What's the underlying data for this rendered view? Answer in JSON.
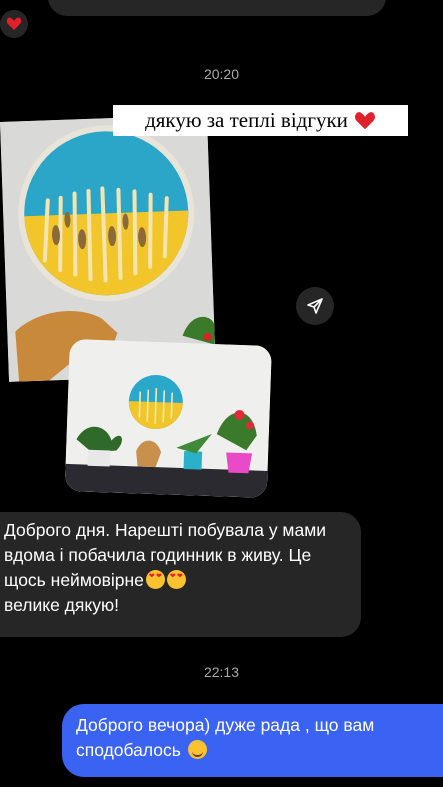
{
  "previous_message": {
    "reaction": "heart-emoji"
  },
  "time_1": "20:20",
  "story_caption": "дякую за теплі відгуки",
  "caption_icon": "heart-emoji",
  "incoming_message": {
    "text": "Доброго дня. Нарешті побувала у мами вдома і побачила годинник в живу. Це щось неймовірне",
    "text_end": "велике дякую!",
    "emoji": "heart-eyes-emoji"
  },
  "time_2": "22:13",
  "outgoing_message": {
    "text": "Доброго вечора) дуже рада , що вам сподобалось",
    "emoji": "smiling-face-with-hearts-emoji"
  },
  "colors": {
    "background": "#000000",
    "incoming_bubble": "#262626",
    "outgoing_bubble": "#3a63f4",
    "time": "#a8a8a8"
  }
}
